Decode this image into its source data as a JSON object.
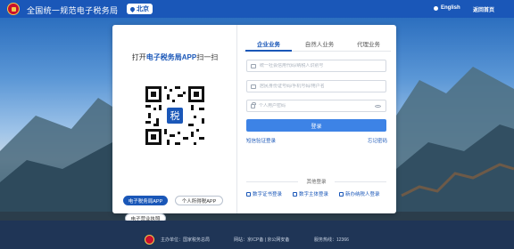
{
  "header": {
    "site_title": "全国统一规范电子税务局",
    "region": "北京",
    "language_label": "English",
    "home_label": "返回首页"
  },
  "scan": {
    "title_prefix": "打开",
    "title_app": "电子税务局APP",
    "title_suffix": "扫一扫",
    "pills": [
      {
        "label": "电子税务局APP",
        "active": true
      },
      {
        "label": "个人所得税APP",
        "active": false
      },
      {
        "label": "电子营业执照",
        "active": false
      }
    ]
  },
  "tabs": [
    {
      "label": "企业业务",
      "active": true
    },
    {
      "label": "自然人业务",
      "active": false
    },
    {
      "label": "代理业务",
      "active": false
    }
  ],
  "form": {
    "credit_code_placeholder": "统一社会信用代码/纳税人识别号",
    "id_placeholder": "居民身份证号码/手机号码/用户名",
    "password_placeholder": "个人用户密码",
    "login_label": "登录",
    "phone_login_link": "短信验证登录",
    "forgot_password_link": "忘记密码"
  },
  "other_login": {
    "label": "其他登录",
    "options": [
      {
        "label": "数字证书登录",
        "icon": "certificate-icon"
      },
      {
        "label": "数字主体登录",
        "icon": "digital-id-icon"
      },
      {
        "label": "新办纳税人登录",
        "icon": "new-taxpayer-icon"
      }
    ]
  },
  "footer": {
    "host": "主办单位：国家税务总局",
    "icp": "网站：京ICP备 | 京公网安备",
    "hotline": "服务热线：12366"
  },
  "colors": {
    "brand_blue": "#1a57b8",
    "button_blue": "#3d83e6",
    "footer_navy": "#1f3556"
  }
}
